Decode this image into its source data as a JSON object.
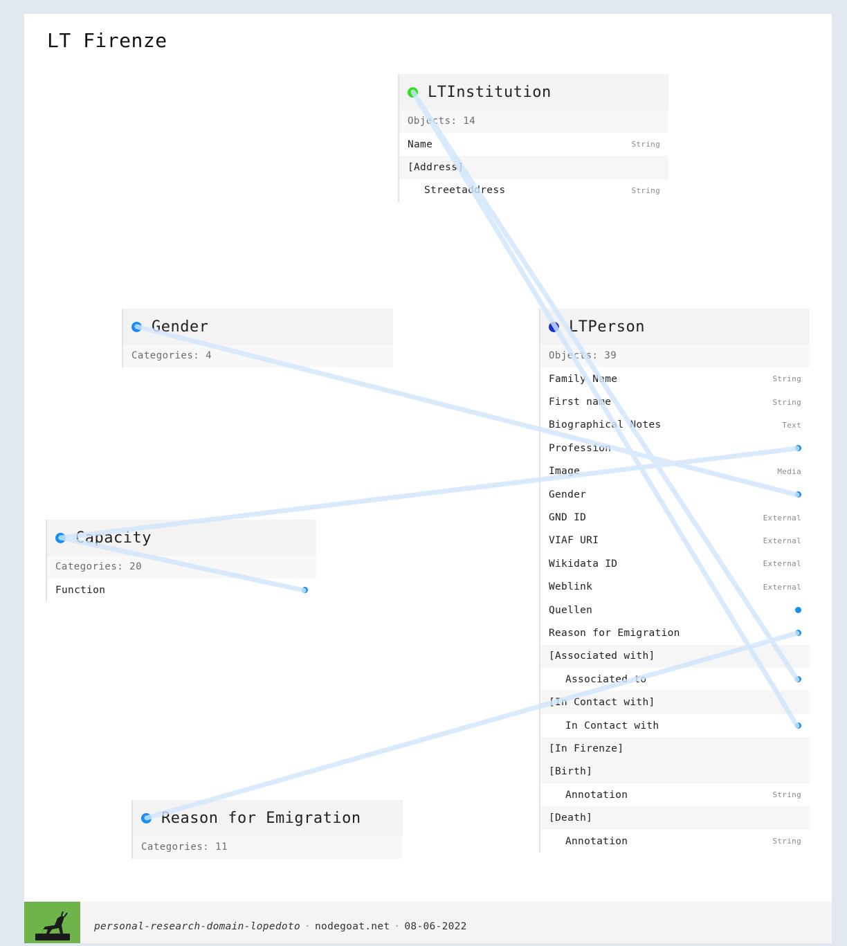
{
  "title": "LT Firenze",
  "colors": {
    "ltinstitution_dot": "#33dd22",
    "ltperson_dot": "#1a2fcf",
    "classification_dot": "#1a8df0",
    "link_line": "#cfe6fb",
    "logo_bg": "#6fb44a"
  },
  "nodes": {
    "ltinstitution": {
      "name": "LTInstitution",
      "count": "Objects: 14",
      "rows": [
        {
          "label": "Name",
          "type": "String"
        },
        {
          "label": "[Address]",
          "type": ""
        },
        {
          "label": "Streetaddress",
          "type": "String"
        }
      ]
    },
    "gender": {
      "name": "Gender",
      "count": "Categories: 4"
    },
    "ltperson": {
      "name": "LTPerson",
      "count": "Objects: 39",
      "rows": [
        {
          "label": "Family Name",
          "type": "String"
        },
        {
          "label": "First name",
          "type": "String"
        },
        {
          "label": "Biographical Notes",
          "type": "Text"
        },
        {
          "label": "Profession",
          "type": ""
        },
        {
          "label": "Image",
          "type": "Media"
        },
        {
          "label": "Gender",
          "type": ""
        },
        {
          "label": "GND ID",
          "type": "External"
        },
        {
          "label": "VIAF URI",
          "type": "External"
        },
        {
          "label": "Wikidata ID",
          "type": "External"
        },
        {
          "label": "Weblink",
          "type": "External"
        },
        {
          "label": "Quellen",
          "type": ""
        },
        {
          "label": "Reason for Emigration",
          "type": ""
        },
        {
          "label": "[Associated with]",
          "type": ""
        },
        {
          "label": "Associated to",
          "type": ""
        },
        {
          "label": "[In Contact with]",
          "type": ""
        },
        {
          "label": "In Contact with",
          "type": ""
        },
        {
          "label": "[In Firenze]",
          "type": ""
        },
        {
          "label": "[Birth]",
          "type": ""
        },
        {
          "label": "Annotation",
          "type": "String"
        },
        {
          "label": "[Death]",
          "type": ""
        },
        {
          "label": "Annotation",
          "type": "String"
        }
      ]
    },
    "capacity": {
      "name": "Capacity",
      "count": "Categories: 20",
      "rows": [
        {
          "label": "Function",
          "type": ""
        }
      ]
    },
    "reason": {
      "name": "Reason for Emigration",
      "count": "Categories: 11"
    }
  },
  "footer": {
    "domain": "personal-research-domain-lopedoto",
    "site": "nodegoat.net",
    "date": "08-06-2022"
  }
}
